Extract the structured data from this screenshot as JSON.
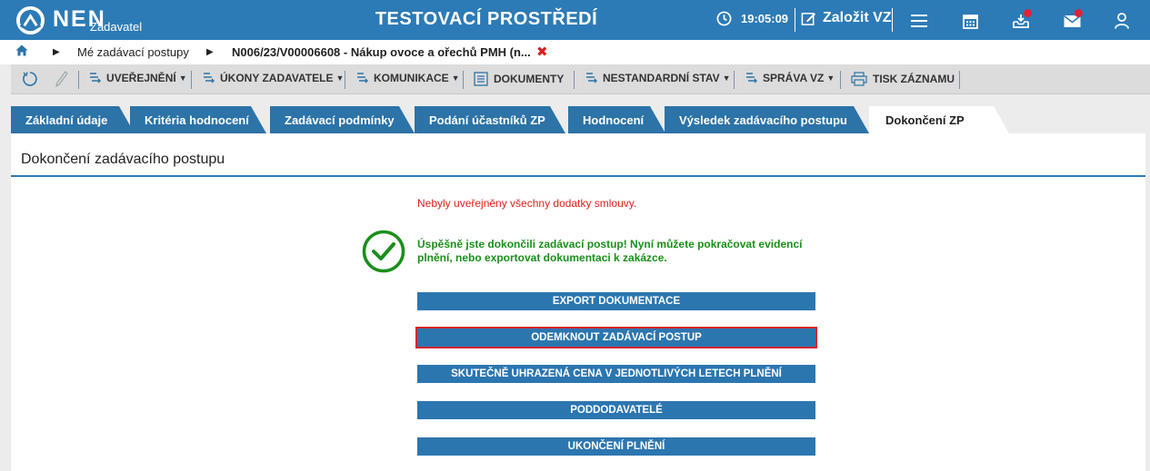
{
  "header": {
    "logo_text": "NEN",
    "logo_sub": "Zadavatel",
    "env_title": "TESTOVACÍ PROSTŘEDÍ",
    "time": "19:05:09",
    "new_vz": "Založit VZ"
  },
  "breadcrumb": {
    "items": [
      "Mé zadávací postupy",
      "N006/23/V00006608 - Nákup ovoce a ořechů PMH (n..."
    ],
    "close": "✖"
  },
  "toolbar": {
    "uverejneni": "UVEŘEJNĚNÍ",
    "ukony": "ÚKONY ZADAVATELE",
    "komunikace": "KOMUNIKACE",
    "dokumenty": "DOKUMENTY",
    "nestandardni": "NESTANDARDNÍ STAV",
    "sprava": "SPRÁVA VZ",
    "tisk": "TISK ZÁZNAMU"
  },
  "tabs": [
    "Základní údaje",
    "Kritéria hodnocení",
    "Zadávací podmínky",
    "Podání účastníků ZP",
    "Hodnocení",
    "Výsledek zadávacího postupu",
    "Dokončení ZP"
  ],
  "panel": {
    "title": "Dokončení zadávacího postupu",
    "warning": "Nebyly uveřejněny všechny dodatky smlouvy.",
    "success": "Úspěšně jste dokončili zadávací postup! Nyní můžete pokračovat evidencí plnění, nebo exportovat dokumentaci k zakázce.",
    "buttons": [
      "EXPORT DOKUMENTACE",
      "ODEMKNOUT ZADÁVACÍ POSTUP",
      "SKUTEČNĚ UHRAZENÁ CENA V JEDNOTLIVÝCH LETECH PLNĚNÍ",
      "PODDODAVATELÉ",
      "UKONČENÍ PLNĚNÍ"
    ]
  },
  "colors": {
    "brand": "#2c7bb6",
    "tab": "#2c73a8",
    "warning": "#e0201b",
    "success": "#1a8f1a",
    "focus": "#d6252c"
  }
}
